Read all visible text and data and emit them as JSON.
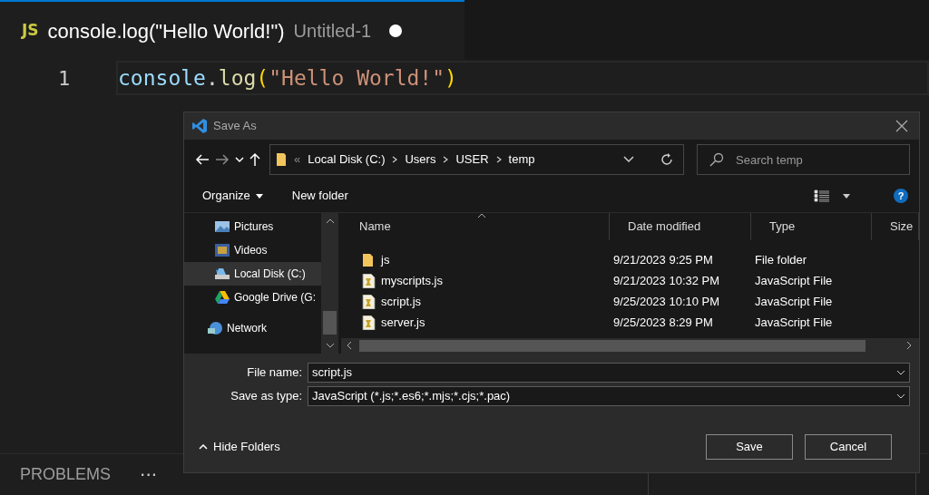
{
  "editor": {
    "tab": {
      "badge": "JS",
      "title": "console.log(\"Hello World!\")",
      "description": "Untitled-1",
      "modified": true
    },
    "lines": [
      {
        "number": "1",
        "tokens": [
          {
            "kind": "variable",
            "text": "console"
          },
          {
            "kind": "punct",
            "text": "."
          },
          {
            "kind": "function",
            "text": "log"
          },
          {
            "kind": "bracket",
            "text": "("
          },
          {
            "kind": "string",
            "text": "\"Hello World!\""
          },
          {
            "kind": "bracket",
            "text": ")"
          }
        ]
      }
    ]
  },
  "panel": {
    "tabs": [
      {
        "label": "PROBLEMS",
        "selected": false
      }
    ],
    "more": "···"
  },
  "dialog": {
    "title": "Save As",
    "address": {
      "overflow": "«",
      "crumbs": [
        "Local Disk (C:)",
        "Users",
        "USER",
        "temp"
      ]
    },
    "search": {
      "placeholder": "Search temp"
    },
    "toolbar": {
      "organize": "Organize",
      "new_folder": "New folder",
      "help": "?"
    },
    "nav_pane": {
      "items": [
        {
          "label": "Pictures",
          "kind": "pictures",
          "selected": false
        },
        {
          "label": "Videos",
          "kind": "videos",
          "selected": false
        },
        {
          "label": "Local Disk (C:)",
          "kind": "disk",
          "selected": true
        },
        {
          "label": "Google Drive (G:",
          "kind": "drive",
          "selected": false
        }
      ],
      "root_items": [
        {
          "label": "Network",
          "kind": "network",
          "selected": false
        }
      ]
    },
    "table": {
      "columns": [
        "Name",
        "Date modified",
        "Type",
        "Size"
      ],
      "rows": [
        {
          "kind": "folder",
          "name": "js",
          "date": "9/21/2023 9:25 PM",
          "type": "File folder"
        },
        {
          "kind": "jsfile",
          "name": "myscripts.js",
          "date": "9/21/2023 10:32 PM",
          "type": "JavaScript File"
        },
        {
          "kind": "jsfile",
          "name": "script.js",
          "date": "9/25/2023 10:10 PM",
          "type": "JavaScript File"
        },
        {
          "kind": "jsfile",
          "name": "server.js",
          "date": "9/25/2023 8:29 PM",
          "type": "JavaScript File"
        }
      ]
    },
    "file_name": {
      "label": "File name:",
      "value": "script.js"
    },
    "save_type": {
      "label": "Save as type:",
      "value": "JavaScript (*.js;*.es6;*.mjs;*.cjs;*.pac)"
    },
    "hide_folders": "Hide Folders",
    "buttons": [
      "Save",
      "Cancel"
    ]
  }
}
